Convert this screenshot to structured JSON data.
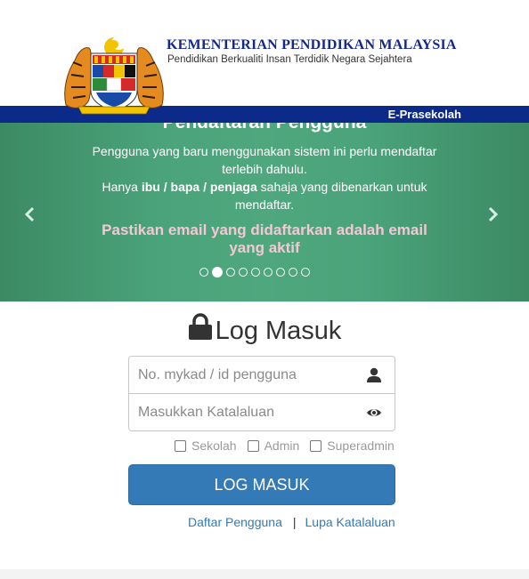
{
  "header": {
    "ministry_name": "KEMENTERIAN PENDIDIKAN MALAYSIA",
    "motto": "Pendidikan Berkualiti Insan Terdidik Negara Sejahtera",
    "crest_icon": "malaysia-coat-of-arms-icon"
  },
  "navbar": {
    "brand": "E-Prasekolah"
  },
  "carousel": {
    "title": "Pendaftaran Pengguna",
    "line1": "Pengguna yang baru menggunakan sistem ini perlu mendaftar terlebih dahulu.",
    "line2_pre": "Hanya ",
    "line2_bold": "ibu / bapa / penjaga",
    "line2_post": " sahaja yang dibenarkan untuk mendaftar.",
    "warning": "Pastikan email yang didaftarkan adalah email yang aktif",
    "prev_icon": "chevron-left-icon",
    "next_icon": "chevron-right-icon",
    "slides_total": 9,
    "active_slide": 2
  },
  "login": {
    "title": "Log Masuk",
    "title_icon": "lock-icon",
    "username": {
      "value": "",
      "placeholder": "No. mykad / id pengguna",
      "icon": "user-icon"
    },
    "password": {
      "value": "",
      "placeholder": "Masukkan Katalaluan",
      "icon": "eye-icon"
    },
    "roles": [
      {
        "label": "Sekolah",
        "checked": false
      },
      {
        "label": "Admin",
        "checked": false
      },
      {
        "label": "Superadmin",
        "checked": false
      }
    ],
    "submit_label": "LOG MASUK",
    "register_link": "Daftar Pengguna",
    "separator": "|",
    "forgot_link": "Lupa Katalaluan"
  },
  "colors": {
    "navy": "#0b2a8a",
    "carousel_green": "#4aa37a",
    "warning_pink": "#f6c6d6",
    "primary_blue": "#337ab7"
  }
}
